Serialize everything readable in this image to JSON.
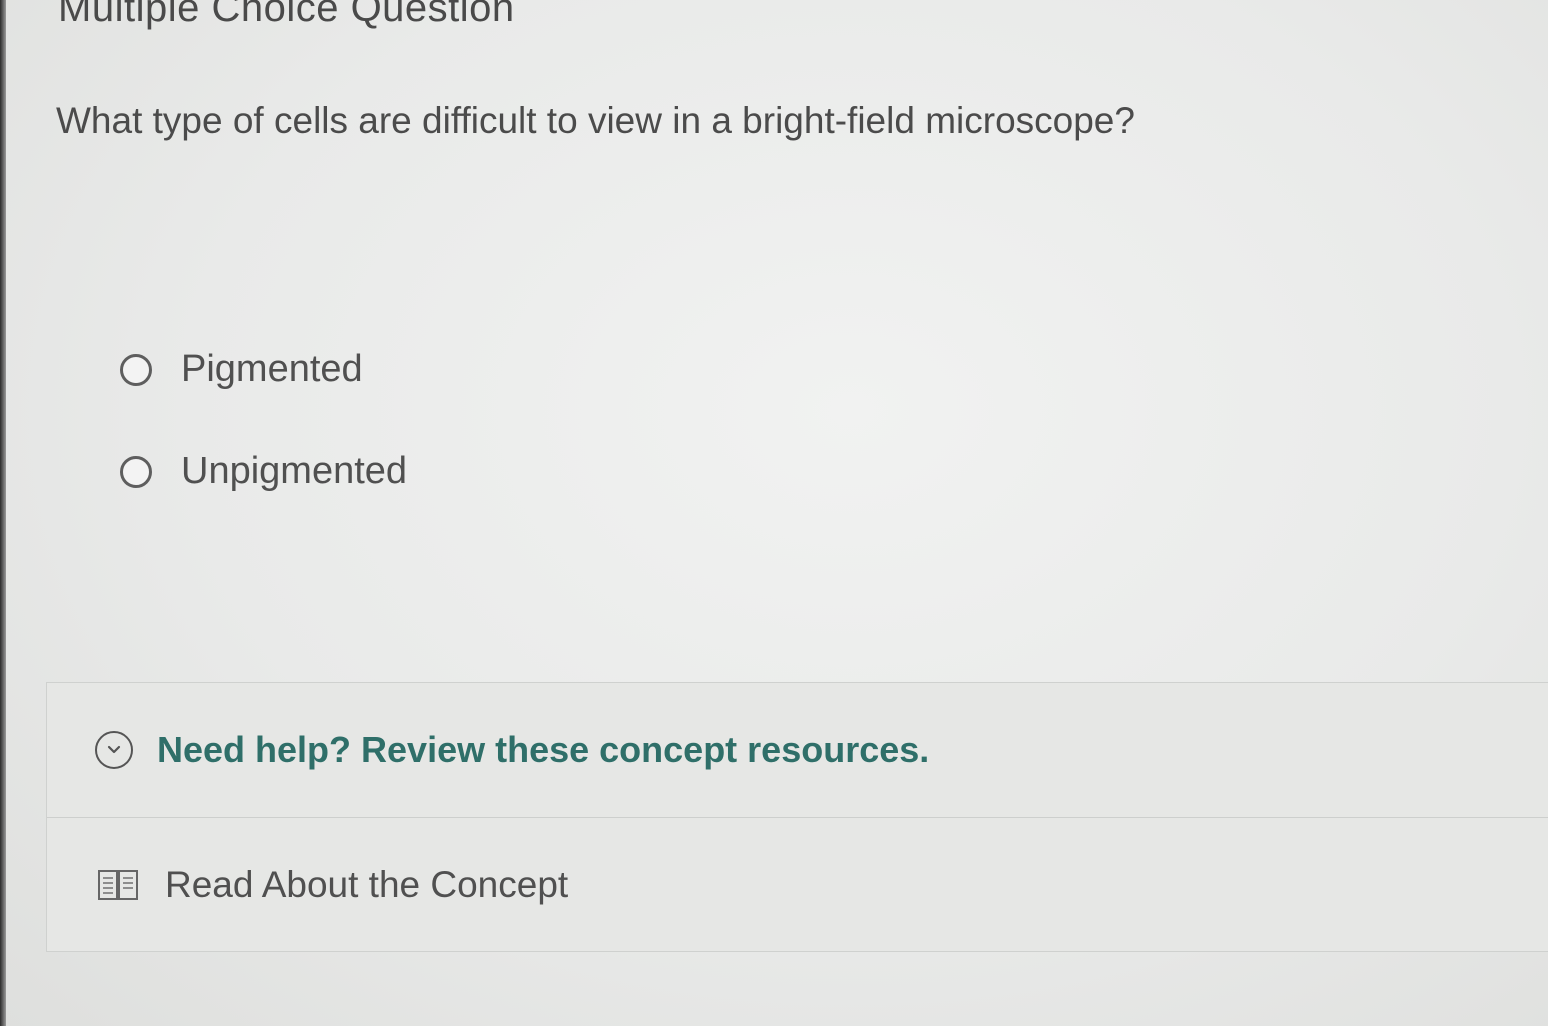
{
  "question": {
    "type_label": "Multiple Choice Question",
    "prompt": "What type of cells are difficult to view in a bright-field microscope?"
  },
  "options": [
    {
      "label": "Pigmented",
      "selected": false
    },
    {
      "label": "Unpigmented",
      "selected": false
    }
  ],
  "help": {
    "title": "Need help? Review these concept resources.",
    "toggle_icon": "chevron-down-circle-icon",
    "resources": [
      {
        "label": "Read About the Concept",
        "icon": "book-icon"
      }
    ]
  },
  "colors": {
    "accent": "#2f6f69",
    "text": "#4b4b4b",
    "background": "#ececeb"
  }
}
